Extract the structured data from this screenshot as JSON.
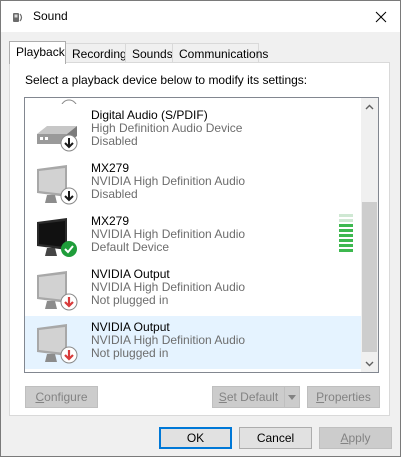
{
  "window": {
    "title": "Sound",
    "close_label": "✕"
  },
  "tabs": [
    {
      "label": "Playback"
    },
    {
      "label": "Recording"
    },
    {
      "label": "Sounds"
    },
    {
      "label": "Communications"
    }
  ],
  "instruction": "Select a playback device below to modify its settings:",
  "devices": [
    {
      "name": "Digital Audio (S/PDIF)",
      "description": "High Definition Audio Device",
      "status": "Disabled",
      "icon": "receiver-icon",
      "badge": "disabled-arrow-icon"
    },
    {
      "name": "MX279",
      "description": "NVIDIA High Definition Audio",
      "status": "Disabled",
      "icon": "monitor-icon",
      "badge": "disabled-arrow-icon"
    },
    {
      "name": "MX279",
      "description": "NVIDIA High Definition Audio",
      "status": "Default Device",
      "icon": "monitor-icon",
      "badge": "default-check-icon"
    },
    {
      "name": "NVIDIA Output",
      "description": "NVIDIA High Definition Audio",
      "status": "Not plugged in",
      "icon": "monitor-icon",
      "badge": "unplugged-arrow-icon"
    },
    {
      "name": "NVIDIA Output",
      "description": "NVIDIA High Definition Audio",
      "status": "Not plugged in",
      "icon": "monitor-icon",
      "badge": "unplugged-arrow-icon"
    }
  ],
  "buttons": {
    "configure": {
      "first": "C",
      "rest": "onfigure"
    },
    "set_default": {
      "first": "S",
      "rest": "et Default"
    },
    "properties": {
      "first": "P",
      "rest": "roperties"
    },
    "ok": "OK",
    "cancel": "Cancel",
    "apply": {
      "first": "A",
      "rest": "pply"
    }
  },
  "colors": {
    "accent": "#0078d7",
    "selection": "#e5f3ff",
    "level_meter": "#3db84f",
    "unplugged_badge": "#d83b3b",
    "default_badge": "#1f9d3a"
  }
}
